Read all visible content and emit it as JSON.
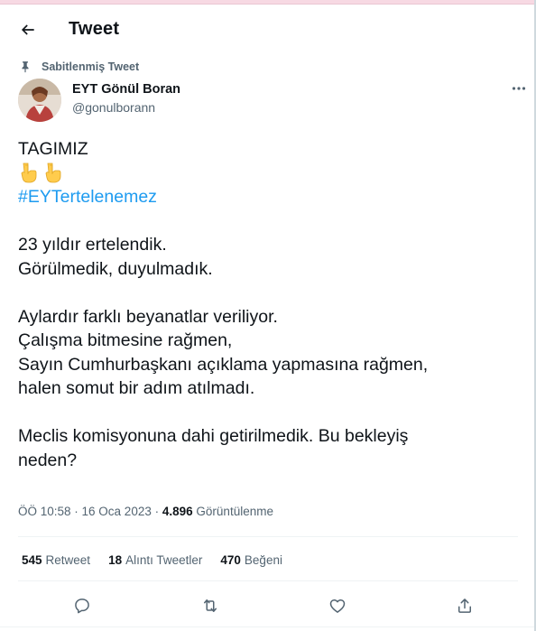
{
  "header": {
    "title": "Tweet",
    "back_icon": "arrow-left-icon"
  },
  "tweet": {
    "pinned_label": "Sabitlenmiş Tweet",
    "author_name": "EYT Gönül Boran",
    "author_handle": "@gonulborann",
    "text": {
      "line1": "TAGIMIZ",
      "emoji": "👇👇",
      "hashtag": "#EYTertelenemez",
      "line4": "23 yıldır ertelendik.",
      "line5": "Görülmedik, duyulmadık.",
      "line6": "Aylardır farklı beyanatlar veriliyor.",
      "line7": "Çalışma bitmesine rağmen,",
      "line8": "Sayın Cumhurbaşkanı açıklama yapmasına rağmen,",
      "line9": "halen somut bir adım atılmadı.",
      "line10": "Meclis komisyonuna dahi getirilmedik. Bu bekleyiş",
      "line11": "neden?"
    },
    "timestamp": "ÖÖ 10:58 · 16 Oca 2023 ·",
    "views_count": "4.896",
    "views_label": "Görüntülenme"
  },
  "stats": {
    "retweets_count": "545",
    "retweets_label": "Retweet",
    "quotes_count": "18",
    "quotes_label": "Alıntı Tweetler",
    "likes_count": "470",
    "likes_label": "Beğeni"
  },
  "colors": {
    "accent": "#1d9bf0",
    "text": "#0f1419",
    "secondary": "#536471",
    "divider": "#eff3f4"
  }
}
